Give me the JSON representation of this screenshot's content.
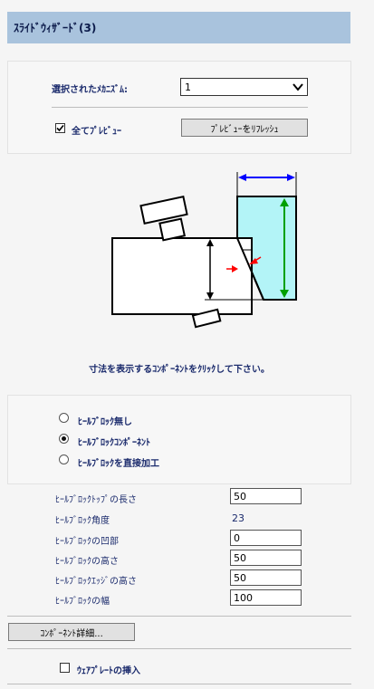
{
  "header": {
    "title": "ｽﾗｲﾄﾞｳｨｻﾞｰﾄﾞ(3)"
  },
  "mechanism": {
    "label": "選択されたﾒｶﾆｽﾞﾑ:",
    "selected": "1"
  },
  "preview": {
    "all_label": "全てﾌﾟﾚﾋﾞｭｰ",
    "all_checked": true,
    "refresh_button": "ﾌﾟﾚﾋﾞｭｰをﾘﾌﾚｯｼｭ"
  },
  "diagram": {
    "hint": "寸法を表示するｺﾝﾎﾟｰﾈﾝﾄをｸﾘｯｸして下さい。",
    "colors": {
      "accent_fill": "#b3f4f7",
      "blue_dim": "#0000ff",
      "green_dim": "#00a000",
      "red_dim": "#ff0000"
    }
  },
  "heel_options": {
    "items": [
      {
        "label": "ﾋｰﾙﾌﾞﾛｯｸ無し",
        "selected": false
      },
      {
        "label": "ﾋｰﾙﾌﾞﾛｯｸｺﾝﾎﾟｰﾈﾝﾄ",
        "selected": true
      },
      {
        "label": "ﾋｰﾙﾌﾞﾛｯｸを直接加工",
        "selected": false
      }
    ]
  },
  "params": {
    "top_length": {
      "label": "ﾋｰﾙﾌﾞﾛｯｸﾄｯﾌﾟの長さ",
      "value": "50"
    },
    "angle": {
      "label": "ﾋｰﾙﾌﾞﾛｯｸ角度",
      "value": "23"
    },
    "recess": {
      "label": "ﾋｰﾙﾌﾞﾛｯｸの凹部",
      "value": "0"
    },
    "height": {
      "label": "ﾋｰﾙﾌﾞﾛｯｸの高さ",
      "value": "50"
    },
    "edge_height": {
      "label": "ﾋｰﾙﾌﾞﾛｯｸｴｯｼﾞの高さ",
      "value": "50"
    },
    "width": {
      "label": "ﾋｰﾙﾌﾞﾛｯｸの幅",
      "value": "100"
    }
  },
  "component_details_button": "ｺﾝﾎﾟｰﾈﾝﾄ詳細...",
  "wear_plate": {
    "label": "ｳｪｱﾌﾟﾚｰﾄの挿入",
    "checked": false
  }
}
